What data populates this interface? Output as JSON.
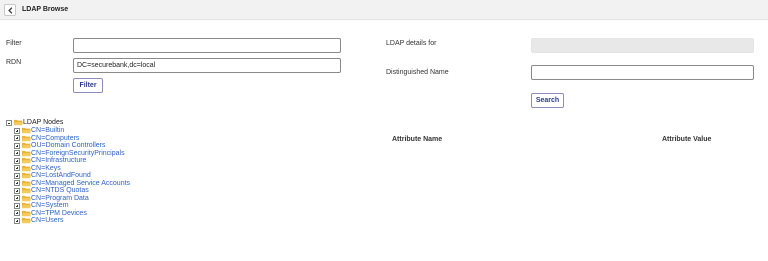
{
  "header": {
    "title": "LDAP Browse",
    "back_icon": "chevron-left-icon"
  },
  "filter_panel": {
    "filter_label": "Filter",
    "filter_value": "",
    "rdn_label": "RDN",
    "rdn_value": "DC=securebank,dc=local",
    "filter_button": "Filter"
  },
  "details_panel": {
    "details_label": "LDAP details for",
    "details_value": "",
    "dn_label": "Distinguished Name",
    "dn_value": "",
    "search_button": "Search"
  },
  "tree": {
    "root_label": "LDAP Nodes",
    "nodes": [
      "CN=Builtin",
      "CN=Computers",
      "OU=Domain Controllers",
      "CN=ForeignSecurityPrincipals",
      "CN=Infrastructure",
      "CN=Keys",
      "CN=LostAndFound",
      "CN=Managed Service Accounts",
      "CN=NTDS Quotas",
      "CN=Program Data",
      "CN=System",
      "CN=TPM Devices",
      "CN=Users"
    ]
  },
  "attributes_table": {
    "columns": [
      "Attribute Name",
      "Attribute Value"
    ],
    "rows": []
  },
  "colors": {
    "link": "#2e63c9",
    "folder": "#e8b33a",
    "button_text": "#2b3a8c",
    "topbar": "#f2f2f2"
  }
}
